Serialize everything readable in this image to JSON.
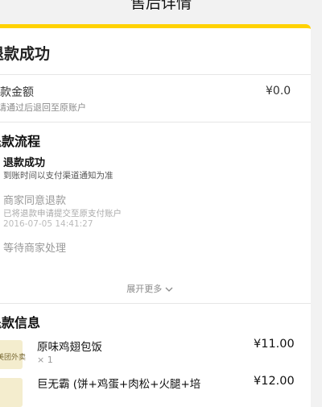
{
  "header": {
    "title": "售后详情"
  },
  "status": {
    "title": "退款成功"
  },
  "amount": {
    "label": "退款金额",
    "sub": "审请通过后退回至原账户",
    "value": "¥0.0"
  },
  "process": {
    "title": "退款流程",
    "steps": [
      {
        "title": "退款成功",
        "sub": "到账时间以支付渠道通知为准"
      },
      {
        "title": "商家同意退款",
        "sub": "已将退款申请提交至原支付账户",
        "time": "2016-07-05 14:41:27"
      },
      {
        "title": "等待商家处理"
      }
    ],
    "expand_label": "展开更多",
    "expand_icon": "chevron-down-icon"
  },
  "info": {
    "title": "退款信息",
    "items": [
      {
        "thumb_text": "美团外卖",
        "name": "原味鸡翅包饭",
        "qty": "× 1",
        "price": "¥11.00"
      },
      {
        "thumb_text": "",
        "name": "巨无霸 (饼+鸡蛋+肉松+火腿+培",
        "price": "¥12.00"
      }
    ]
  },
  "colors": {
    "accent": "#ffd200",
    "background": "#f2f2f2"
  }
}
